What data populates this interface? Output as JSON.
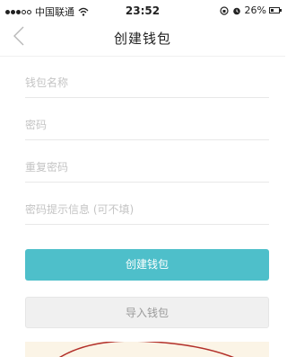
{
  "status_bar": {
    "carrier": "中国联通",
    "time": "23:52",
    "battery": "26%"
  },
  "nav": {
    "title": "创建钱包"
  },
  "form": {
    "wallet_name_placeholder": "钱包名称",
    "password_placeholder": "密码",
    "repeat_password_placeholder": "重复密码",
    "hint_placeholder": "密码提示信息 (可不填)"
  },
  "buttons": {
    "create_label": "创建钱包",
    "import_label": "导入钱包"
  },
  "colors": {
    "accent": "#4ebfca",
    "secondary_button": "#f0f0f0",
    "notice_background": "#fbf4e6",
    "annotation_circle": "#b3302a"
  }
}
